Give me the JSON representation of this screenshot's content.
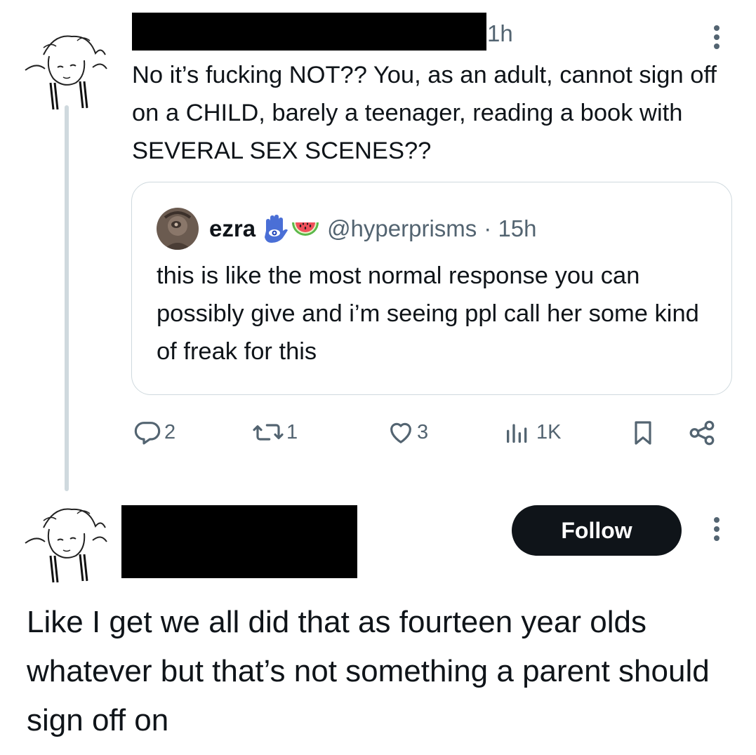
{
  "reply_tweet": {
    "time": "1h",
    "text": "No it’s fucking NOT?? You, as an adult, cannot sign off on a CHILD, barely a teenager, reading a book with SEVERAL SEX SCENES??"
  },
  "quoted_tweet": {
    "name": "ezra",
    "badge_icons": [
      "hamsa-icon",
      "watermelon-icon"
    ],
    "handle": "@hyperprisms",
    "time": "· 15h",
    "text": "this is like the most normal response you can possibly give and i’m seeing ppl call her some kind of freak for this"
  },
  "actions": {
    "replies": "2",
    "reposts": "1",
    "likes": "3",
    "views": "1K"
  },
  "main_tweet": {
    "follow_label": "Follow",
    "text": "Like I get we all did that as fourteen year olds whatever but that’s not something a parent should sign off on"
  },
  "colors": {
    "text": "#0f1419",
    "secondary": "#536471",
    "border": "#cfd9de",
    "follow_bg": "#0f1419"
  }
}
